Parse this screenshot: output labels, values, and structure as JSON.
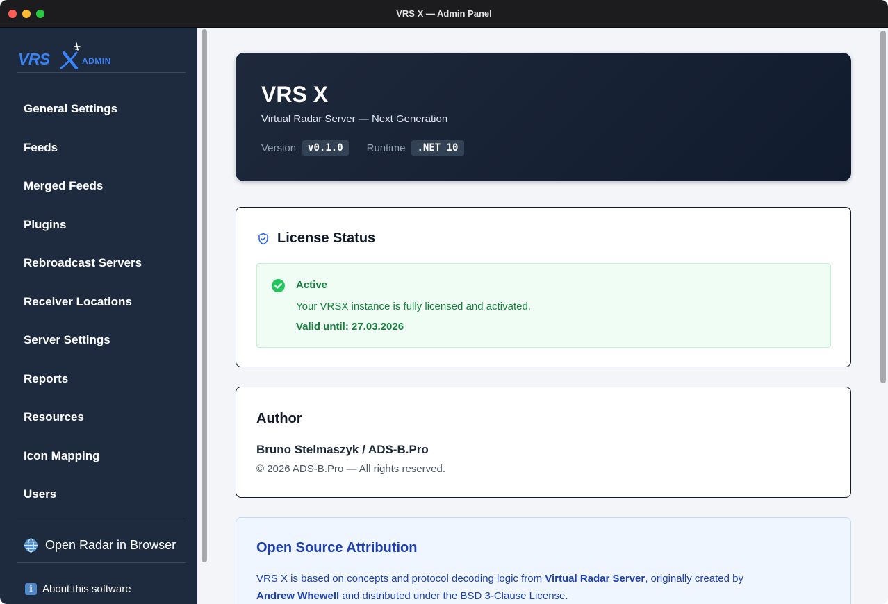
{
  "window": {
    "title": "VRS X — Admin Panel"
  },
  "logo": {
    "text": "VRS",
    "badge": "ADMIN",
    "accent": "#3b82f6"
  },
  "sidebar": {
    "items": [
      {
        "label": "General Settings"
      },
      {
        "label": "Feeds"
      },
      {
        "label": "Merged Feeds"
      },
      {
        "label": "Plugins"
      },
      {
        "label": "Rebroadcast Servers"
      },
      {
        "label": "Receiver Locations"
      },
      {
        "label": "Server Settings"
      },
      {
        "label": "Reports"
      },
      {
        "label": "Resources"
      },
      {
        "label": "Icon Mapping"
      },
      {
        "label": "Users"
      }
    ],
    "open_radar": {
      "label": "Open Radar in Browser",
      "icon": "globe-icon"
    },
    "about": {
      "label": "About this software",
      "icon": "info-icon"
    }
  },
  "hero": {
    "title": "VRS X",
    "subtitle": "Virtual Radar Server — Next Generation",
    "version_label": "Version",
    "version_value": "v0.1.0",
    "runtime_label": "Runtime",
    "runtime_value": ".NET 10"
  },
  "license": {
    "title": "License Status",
    "icon": "shield-check-icon",
    "status": "Active",
    "description": "Your VRSX instance is fully licensed and activated.",
    "valid_until": "Valid until: 27.03.2026",
    "status_color": "#15803d"
  },
  "author": {
    "title": "Author",
    "name": "Bruno Stelmaszyk / ADS-B.Pro",
    "copyright": "© 2026 ADS-B.Pro — All rights reserved."
  },
  "attribution": {
    "title": "Open Source Attribution",
    "text_1": "VRS X is based on concepts and protocol decoding logic from ",
    "bold_1": "Virtual Radar Server",
    "text_2": ", originally created by",
    "bold_2": "Andrew Whewell",
    "text_3": " and distributed under the BSD 3-Clause License."
  }
}
